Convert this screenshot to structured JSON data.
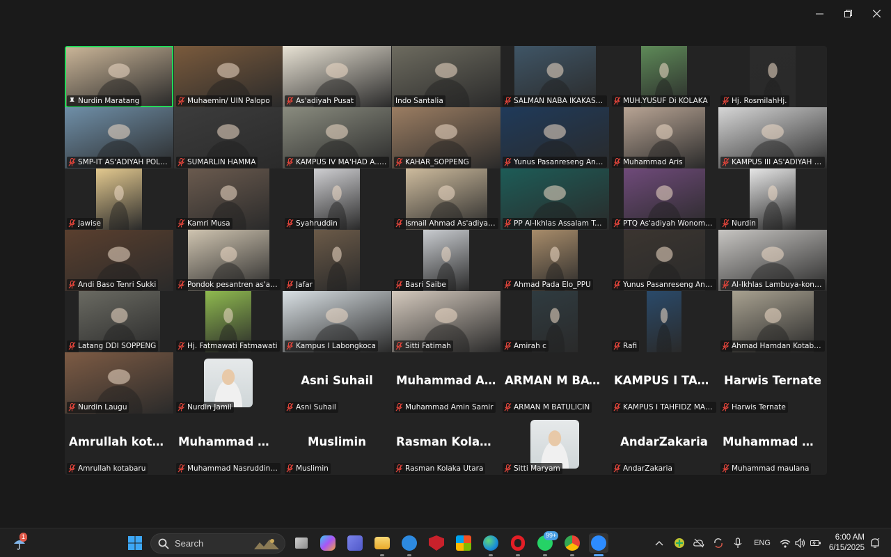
{
  "window": {
    "controls": [
      "minimize",
      "restore",
      "close"
    ]
  },
  "grid": {
    "rows": [
      [
        {
          "name": "Nurdin Maratang",
          "video": true,
          "active": true,
          "pinned": true
        },
        {
          "name": "Muhaemin/ UIN Palopo",
          "video": true
        },
        {
          "name": "As'adiyah Pusat",
          "video": true
        },
        {
          "name": "Indo Santalia",
          "video": true,
          "unmuted": true
        },
        {
          "name": "SALMAN NABA  IKAKAS B...",
          "video": true
        },
        {
          "name": "MUH.YUSUF Di KOLAKA",
          "video": true
        },
        {
          "name": "Hj. RosmilahHj.",
          "video": true
        }
      ],
      [
        {
          "name": "SMP-IT AS'ADIYAH POLEW...",
          "video": true
        },
        {
          "name": "SUMARLIN HAMMA",
          "video": true
        },
        {
          "name": "KAMPUS IV  MA'HAD A..Y...",
          "video": true
        },
        {
          "name": "KAHAR_SOPPENG",
          "video": true
        },
        {
          "name": "Yunus Pasanreseng Andi P...",
          "video": true
        },
        {
          "name": "Muhammad Aris",
          "video": true
        },
        {
          "name": "KAMPUS III AS'ADIYAH PU...",
          "video": true
        }
      ],
      [
        {
          "name": "Jawise",
          "video": true
        },
        {
          "name": "Kamri Musa",
          "video": true
        },
        {
          "name": "Syahruddin",
          "video": true
        },
        {
          "name": "Ismail Ahmad As'adiyah Ba...",
          "video": true
        },
        {
          "name": "PP Al-Ikhlas Assalam Tange...",
          "video": true
        },
        {
          "name": "PTQ As'adiyah Wonomuly...",
          "video": true
        },
        {
          "name": "Nurdin",
          "video": true
        }
      ],
      [
        {
          "name": "Andi Baso Tenri Sukki",
          "video": true
        },
        {
          "name": "Pondok pesantren as'adiya...",
          "video": true
        },
        {
          "name": "Jafar",
          "video": true
        },
        {
          "name": "Basri Saibe",
          "video": true
        },
        {
          "name": "Ahmad Pada Elo_PPU",
          "video": true
        },
        {
          "name": "Yunus Pasanreseng Andi P...",
          "video": true
        },
        {
          "name": "Al-Ikhlas Lambuya-konawe",
          "video": true
        }
      ],
      [
        {
          "name": "Latang DDI SOPPENG",
          "video": true
        },
        {
          "name": "Hj. Fatmawati Fatmawati",
          "video": true
        },
        {
          "name": "Kampus  I Labongkoca",
          "video": true
        },
        {
          "name": "Sitti Fatimah",
          "video": true
        },
        {
          "name": "Amirah c",
          "video": true
        },
        {
          "name": "Rafi",
          "video": true
        },
        {
          "name": "Ahmad Hamdan Kotabaru ...",
          "video": true
        }
      ],
      [
        {
          "name": "Nurdin Laugu",
          "video": true
        },
        {
          "name": "Nurdin Jamil",
          "photo": true
        },
        {
          "name": "Asni Suhail",
          "big": "Asni Suhail"
        },
        {
          "name": "Muhammad Amin Samir",
          "big": "Muhammad  Am..."
        },
        {
          "name": "ARMAN M BATULICIN",
          "big": "ARMAN M BAT..."
        },
        {
          "name": "KAMPUS I TAHFIDZ MASJI...",
          "big": "KAMPUS I TAHF..."
        },
        {
          "name": "Harwis Ternate",
          "big": "Harwis Ternate"
        }
      ],
      [
        {
          "name": "Amrullah kotabaru",
          "big": "Amrullah  kotab..."
        },
        {
          "name": "Muhammad Nasruddin Ba...",
          "big": "Muhammad  Na..."
        },
        {
          "name": "Muslimin",
          "big": "Muslimin"
        },
        {
          "name": "Rasman Kolaka Utara",
          "big": "Rasman  Kolaka..."
        },
        {
          "name": "Sitti Maryam",
          "photo": true
        },
        {
          "name": "AndarZakaria",
          "big": "AndarZakaria"
        },
        {
          "name": "Muhammad maulana",
          "big": "Muhammad  ma..."
        }
      ]
    ]
  },
  "taskbar": {
    "search_label": "Search",
    "weather_badge": "1",
    "whatsapp_badge": "99+",
    "language": "ENG",
    "time": "6:00 AM",
    "date": "6/15/2025",
    "icons": [
      "start-icon",
      "search-icon",
      "task-view-icon",
      "copilot-icon",
      "teams-icon",
      "file-explorer-icon",
      "get-help-icon",
      "mcafee-icon",
      "microsoft-store-icon",
      "edge-icon",
      "opera-icon",
      "whatsapp-icon",
      "chrome-icon",
      "zoom-icon"
    ]
  },
  "colors": {
    "active_speaker": "#23d959",
    "muted": "#e0443a",
    "background": "#1a1a1a",
    "tile": "#232323"
  }
}
